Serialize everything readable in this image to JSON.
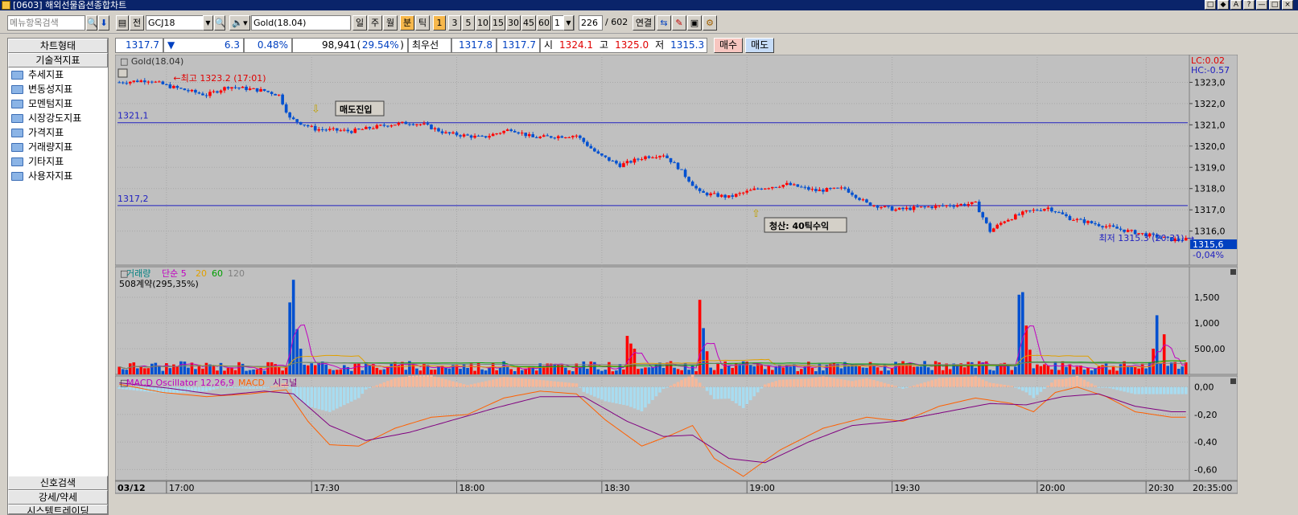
{
  "window": {
    "title": "[0603] 해외선물옵션종합차트",
    "buttons": [
      "□",
      "◆",
      "A",
      "?",
      "—",
      "□",
      "×"
    ]
  },
  "toolbar": {
    "menu_search_placeholder": "메뉴항목검색",
    "front_label": "전",
    "code": "GCJ18",
    "name": "Gold(18.04)",
    "periods": [
      "일",
      "주",
      "월",
      "분",
      "틱"
    ],
    "active_period": "분",
    "interval_box": "1",
    "minutes": [
      "3",
      "5",
      "10",
      "15",
      "30",
      "45",
      "60"
    ],
    "tick_box": "1",
    "count": "226",
    "total": "/ 602",
    "link_label": "연결"
  },
  "left_panel": {
    "header_chart_type": "차트형태",
    "header_indicators": "기술적지표",
    "items": [
      "추세지표",
      "변동성지표",
      "모멘텀지표",
      "시장강도지표",
      "가격지표",
      "거래량지표",
      "기타지표",
      "사용자지표"
    ],
    "bottom": [
      "신호검색",
      "강세/약세",
      "시스템트레이딩"
    ]
  },
  "quote": {
    "price": "1317.7",
    "change_arrow": "▼",
    "change": "6.3",
    "pct": "0.48%",
    "volume": "98,941",
    "vol_pct": "29.54%",
    "best_label": "최우선",
    "ask": "1317.8",
    "bid": "1317.7",
    "open_label": "시",
    "open": "1324.1",
    "high_label": "고",
    "high": "1325.0",
    "low_label": "저",
    "low": "1315.3"
  },
  "trade": {
    "buy": "매수",
    "sell": "매도"
  },
  "chart_data": [
    {
      "type": "candlestick",
      "title": "Gold(18.04)",
      "ylim": [
        1314.7,
        1324.0
      ],
      "yticks": [
        1323.0,
        1322.0,
        1321.0,
        1320.0,
        1319.0,
        1318.0,
        1317.0,
        1316.0
      ],
      "ytick_labels": [
        "1323,0",
        "1322,0",
        "1321,0",
        "1320,0",
        "1319,0",
        "1318,0",
        "1317,0",
        "1316,0"
      ],
      "hlines": [
        {
          "value": 1321.1,
          "label": "1321,1"
        },
        {
          "value": 1317.2,
          "label": "1317,2"
        }
      ],
      "lc": "LC:0.02",
      "hc": "HC:-0.57",
      "annotations": {
        "high": "최고 1323.2 (17:01)",
        "low": "최저 1315.3 (20:31)",
        "entry": "매도진입",
        "exit": "청산: 40틱수익"
      },
      "last_price_box": "1315,6",
      "last_pct": "-0,04%",
      "colors": {
        "up": "#ff0000",
        "down": "#0050d0"
      },
      "close_anchors": [
        [
          0,
          1323.0
        ],
        [
          8,
          1323.1
        ],
        [
          14,
          1322.8
        ],
        [
          24,
          1322.4
        ],
        [
          30,
          1322.8
        ],
        [
          40,
          1322.6
        ],
        [
          44,
          1322.4
        ],
        [
          47,
          1321.3
        ],
        [
          54,
          1320.8
        ],
        [
          64,
          1320.7
        ],
        [
          74,
          1321.0
        ],
        [
          80,
          1321.1
        ],
        [
          84,
          1321.0
        ],
        [
          90,
          1320.6
        ],
        [
          100,
          1320.4
        ],
        [
          108,
          1320.8
        ],
        [
          114,
          1320.4
        ],
        [
          126,
          1320.5
        ],
        [
          132,
          1319.6
        ],
        [
          138,
          1319.1
        ],
        [
          145,
          1319.5
        ],
        [
          150,
          1319.6
        ],
        [
          154,
          1319.0
        ],
        [
          160,
          1317.8
        ],
        [
          168,
          1317.6
        ],
        [
          176,
          1318.0
        ],
        [
          184,
          1318.2
        ],
        [
          192,
          1317.9
        ],
        [
          200,
          1318.0
        ],
        [
          206,
          1317.3
        ],
        [
          214,
          1317.0
        ],
        [
          220,
          1317.1
        ],
        [
          228,
          1317.2
        ],
        [
          236,
          1317.3
        ],
        [
          240,
          1316.0
        ],
        [
          244,
          1316.5
        ],
        [
          250,
          1316.9
        ],
        [
          256,
          1317.1
        ],
        [
          262,
          1316.6
        ],
        [
          270,
          1316.3
        ],
        [
          278,
          1316.0
        ],
        [
          284,
          1315.8
        ],
        [
          290,
          1315.6
        ]
      ]
    },
    {
      "type": "bar",
      "title": "거래량",
      "legend": [
        "단순 5",
        "20",
        "60",
        "120"
      ],
      "legend_colors": [
        "#c000c0",
        "#e0a000",
        "#00a000",
        "#808080"
      ],
      "subtitle": "508계약(295,35%)",
      "ylim": [
        0,
        2000
      ],
      "yticks": [
        500,
        1000,
        1500
      ],
      "ytick_labels": [
        "500,00",
        "1,000",
        "1,500"
      ],
      "spikes": [
        [
          47,
          1400
        ],
        [
          48,
          1840
        ],
        [
          49,
          880
        ],
        [
          50,
          500
        ],
        [
          140,
          750
        ],
        [
          141,
          600
        ],
        [
          142,
          500
        ],
        [
          160,
          1450
        ],
        [
          161,
          900
        ],
        [
          162,
          450
        ],
        [
          248,
          1550
        ],
        [
          249,
          1600
        ],
        [
          250,
          950
        ],
        [
          251,
          480
        ],
        [
          286,
          1150
        ],
        [
          288,
          780
        ],
        [
          285,
          500
        ]
      ]
    },
    {
      "type": "line",
      "title": "MACD Oscillator 12,26,9",
      "series_names": [
        "MACD",
        "시그널"
      ],
      "series_colors": [
        "#ff6000",
        "#800080"
      ],
      "ylim": [
        -0.68,
        0.08
      ],
      "yticks": [
        0.0,
        -0.2,
        -0.4,
        -0.6
      ],
      "ytick_labels": [
        "0,00",
        "-0,20",
        "-0,40",
        "-0,60"
      ],
      "macd": [
        [
          0,
          0.02
        ],
        [
          12,
          -0.04
        ],
        [
          24,
          -0.07
        ],
        [
          36,
          -0.05
        ],
        [
          46,
          -0.02
        ],
        [
          52,
          -0.25
        ],
        [
          58,
          -0.42
        ],
        [
          66,
          -0.43
        ],
        [
          76,
          -0.3
        ],
        [
          86,
          -0.22
        ],
        [
          96,
          -0.2
        ],
        [
          106,
          -0.08
        ],
        [
          116,
          -0.03
        ],
        [
          126,
          -0.05
        ],
        [
          134,
          -0.24
        ],
        [
          144,
          -0.43
        ],
        [
          152,
          -0.35
        ],
        [
          158,
          -0.28
        ],
        [
          164,
          -0.52
        ],
        [
          172,
          -0.65
        ],
        [
          182,
          -0.46
        ],
        [
          194,
          -0.3
        ],
        [
          206,
          -0.22
        ],
        [
          216,
          -0.25
        ],
        [
          226,
          -0.14
        ],
        [
          236,
          -0.08
        ],
        [
          246,
          -0.12
        ],
        [
          252,
          -0.18
        ],
        [
          258,
          -0.04
        ],
        [
          264,
          0.0
        ],
        [
          272,
          -0.07
        ],
        [
          280,
          -0.18
        ],
        [
          290,
          -0.22
        ]
      ],
      "signal": [
        [
          0,
          0.03
        ],
        [
          14,
          -0.01
        ],
        [
          28,
          -0.06
        ],
        [
          40,
          -0.03
        ],
        [
          48,
          -0.05
        ],
        [
          58,
          -0.28
        ],
        [
          68,
          -0.39
        ],
        [
          80,
          -0.33
        ],
        [
          92,
          -0.24
        ],
        [
          104,
          -0.15
        ],
        [
          116,
          -0.07
        ],
        [
          128,
          -0.07
        ],
        [
          140,
          -0.25
        ],
        [
          150,
          -0.36
        ],
        [
          158,
          -0.35
        ],
        [
          168,
          -0.52
        ],
        [
          178,
          -0.55
        ],
        [
          190,
          -0.4
        ],
        [
          202,
          -0.28
        ],
        [
          214,
          -0.25
        ],
        [
          226,
          -0.19
        ],
        [
          240,
          -0.12
        ],
        [
          250,
          -0.13
        ],
        [
          260,
          -0.07
        ],
        [
          270,
          -0.05
        ],
        [
          280,
          -0.14
        ],
        [
          290,
          -0.18
        ]
      ],
      "osc_colors": {
        "pos": "#f6b89a",
        "neg": "#a8dcf0"
      }
    }
  ],
  "xaxis": {
    "date_label": "03/12",
    "ticks": [
      {
        "bar": 13,
        "label": "17:00"
      },
      {
        "bar": 53,
        "label": "17:30"
      },
      {
        "bar": 93,
        "label": "18:00"
      },
      {
        "bar": 133,
        "label": "18:30"
      },
      {
        "bar": 173,
        "label": "19:00"
      },
      {
        "bar": 213,
        "label": "19:30"
      },
      {
        "bar": 253,
        "label": "20:00"
      },
      {
        "bar": 283,
        "label": "20:30"
      }
    ],
    "cursor_time": "20:35:00",
    "n_bars": 295
  }
}
